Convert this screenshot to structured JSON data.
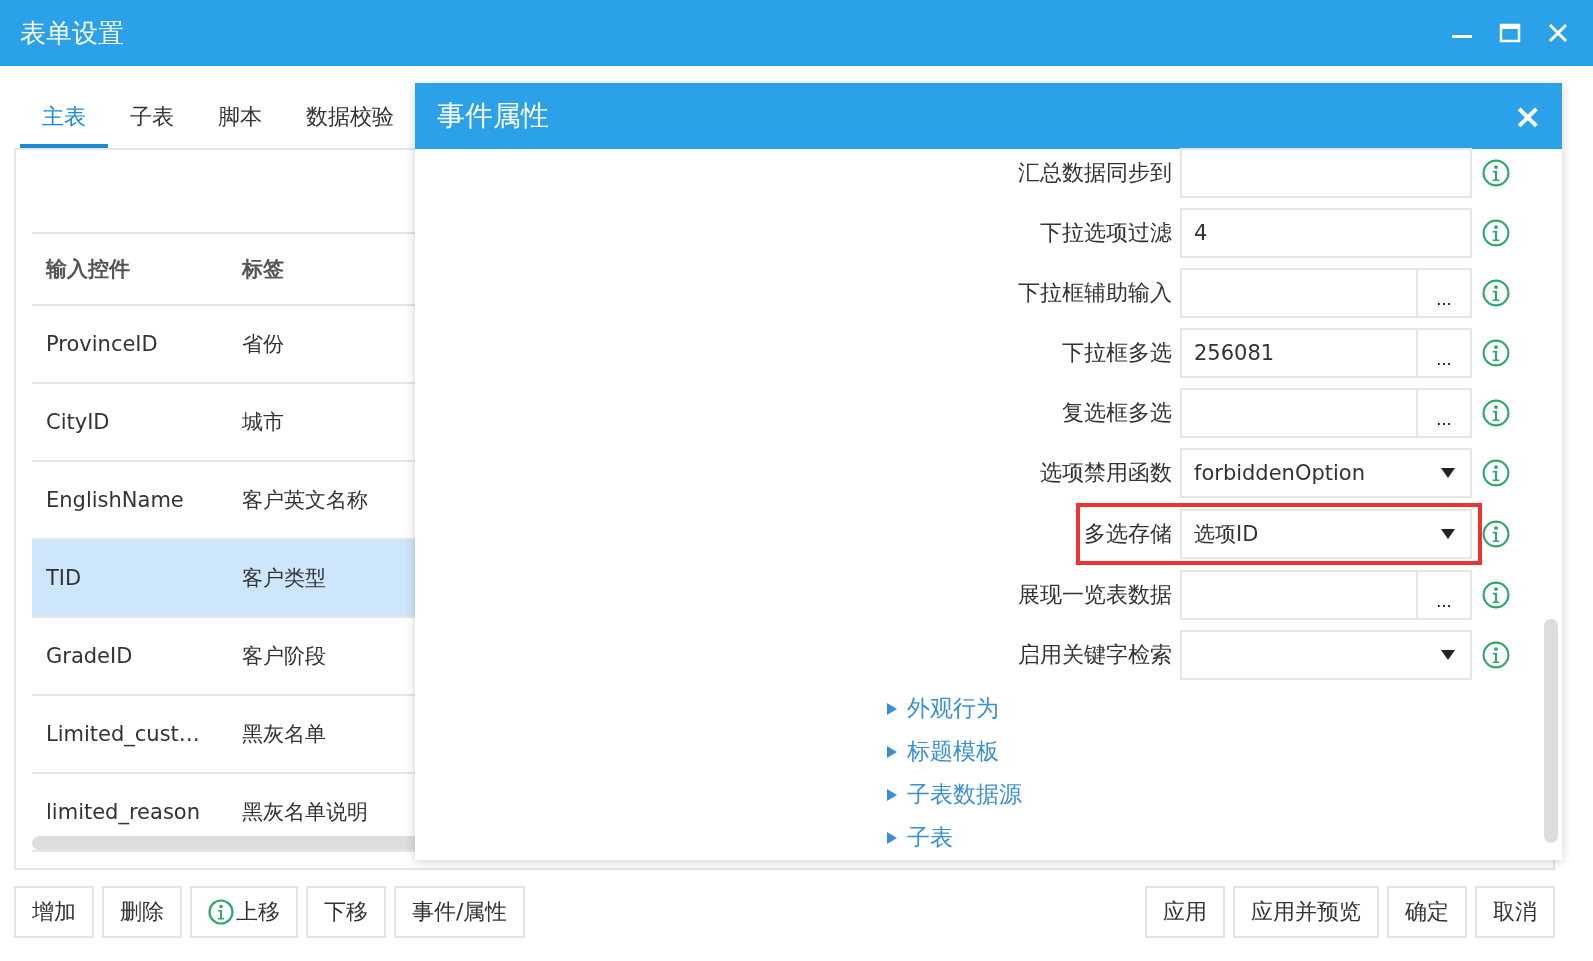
{
  "window": {
    "title": "表单设置"
  },
  "tabs": [
    {
      "label": "主表",
      "selected": true
    },
    {
      "label": "子表",
      "selected": false
    },
    {
      "label": "脚本",
      "selected": false
    },
    {
      "label": "数据校验",
      "selected": false
    }
  ],
  "table": {
    "columns": [
      "输入控件",
      "标签"
    ],
    "rows": [
      {
        "control": "ProvinceID",
        "label": "省份",
        "selected": false
      },
      {
        "control": "CityID",
        "label": "城市",
        "selected": false
      },
      {
        "control": "EnglishName",
        "label": "客户英文名称",
        "selected": false
      },
      {
        "control": "TID",
        "label": "客户类型",
        "selected": true
      },
      {
        "control": "GradeID",
        "label": "客户阶段",
        "selected": false
      },
      {
        "control": "Limited_cust…",
        "label": "黑灰名单",
        "selected": false
      },
      {
        "control": "limited_reason",
        "label": "黑灰名单说明",
        "selected": false
      }
    ]
  },
  "dialog": {
    "title": "事件属性",
    "close": "×",
    "properties": [
      {
        "label": "汇总数据同步到",
        "kind": "text",
        "highlighted": false
      },
      {
        "label": "下拉选项过滤",
        "kind": "text",
        "value": "4",
        "highlighted": false
      },
      {
        "label": "下拉框辅助输入",
        "kind": "picker",
        "button": "...",
        "highlighted": false
      },
      {
        "label": "下拉框多选",
        "kind": "picker",
        "value": "256081",
        "button": "...",
        "highlighted": false
      },
      {
        "label": "复选框多选",
        "kind": "picker",
        "button": "...",
        "highlighted": false
      },
      {
        "label": "选项禁用函数",
        "kind": "select",
        "value": "forbiddenOption",
        "highlighted": false
      },
      {
        "label": "多选存储",
        "kind": "select",
        "value": "选项ID",
        "highlighted": true
      },
      {
        "label": "展现一览表数据",
        "kind": "picker",
        "button": "...",
        "highlighted": false
      },
      {
        "label": "启用关键字检索",
        "kind": "select",
        "highlighted": false
      }
    ],
    "sections": [
      {
        "label": "外观行为",
        "expanded": false
      },
      {
        "label": "标题模板",
        "expanded": false
      },
      {
        "label": "子表数据源",
        "expanded": false
      },
      {
        "label": "子表",
        "expanded": false
      }
    ]
  },
  "left_buttons": [
    {
      "label": "增加",
      "icon": false
    },
    {
      "label": "删除",
      "icon": false
    },
    {
      "label": "上移",
      "icon": true
    },
    {
      "label": "下移",
      "icon": false
    },
    {
      "label": "事件/属性",
      "icon": false
    }
  ],
  "right_buttons": [
    "应用",
    "应用并预览",
    "确定",
    "取消"
  ]
}
